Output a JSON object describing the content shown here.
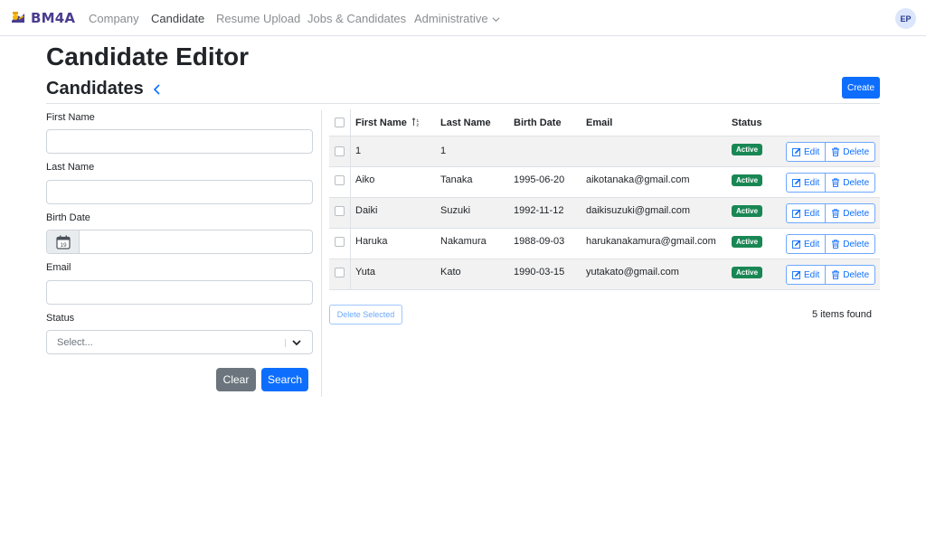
{
  "nav": {
    "brand": "BM4A",
    "links": [
      "Company",
      "Candidate",
      "Resume Upload",
      "Jobs & Candidates",
      "Administrative"
    ],
    "avatar": "EP"
  },
  "page": {
    "title": "Candidate Editor",
    "section": "Candidates",
    "create_label": "Create"
  },
  "form": {
    "first_name_label": "First Name",
    "last_name_label": "Last Name",
    "birth_date_label": "Birth Date",
    "email_label": "Email",
    "status_label": "Status",
    "status_placeholder": "Select...",
    "calendar_day": "19",
    "clear_label": "Clear",
    "search_label": "Search"
  },
  "table": {
    "headers": [
      "First Name",
      "Last Name",
      "Birth Date",
      "Email",
      "Status"
    ],
    "rows": [
      {
        "first": "1",
        "last": "1",
        "birth": "",
        "email": "",
        "status": "Active"
      },
      {
        "first": "Aiko",
        "last": "Tanaka",
        "birth": "1995-06-20",
        "email": "aikotanaka@gmail.com",
        "status": "Active"
      },
      {
        "first": "Daiki",
        "last": "Suzuki",
        "birth": "1992-11-12",
        "email": "daikisuzuki@gmail.com",
        "status": "Active"
      },
      {
        "first": "Haruka",
        "last": "Nakamura",
        "birth": "1988-09-03",
        "email": "harukanakamura@gmail.com",
        "status": "Active"
      },
      {
        "first": "Yuta",
        "last": "Kato",
        "birth": "1990-03-15",
        "email": "yutakato@gmail.com",
        "status": "Active"
      }
    ],
    "edit_label": "Edit",
    "delete_label": "Delete"
  },
  "footer": {
    "delete_selected_label": "Delete Selected",
    "items_found": "5 items found"
  },
  "colors": {
    "primary": "#0d6efd",
    "success": "#198754",
    "secondary": "#6c757d",
    "brand": "#4a3d8f"
  }
}
